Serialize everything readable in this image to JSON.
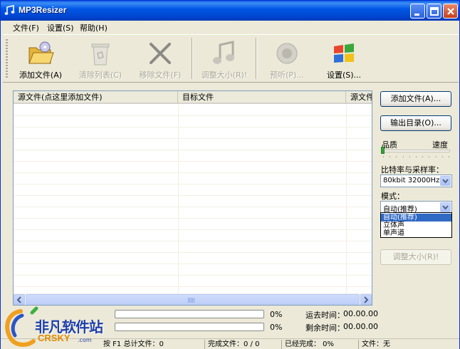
{
  "window": {
    "title": "MP3Resizer"
  },
  "menu": [
    "文件(F)",
    "设置(S)",
    "帮助(H)"
  ],
  "toolbar": {
    "add_files": "添加文件(A)",
    "clear_list": "清除列表(C)",
    "remove_files": "移除文件(F)",
    "resize": "调整大小(R)!",
    "preview": "预听(P)...",
    "settings": "设置(S)..."
  },
  "list": {
    "columns": [
      "源文件(点这里添加文件)",
      "目标文件",
      "源文件"
    ]
  },
  "panel": {
    "add_files_btn": "添加文件(A)...",
    "output_dir_btn": "输出目录(O)...",
    "quality_label": "品质",
    "speed_label": "速度",
    "quality_speed_level": 0,
    "bitrate_label": "比特率与采样率：",
    "bitrate_value": "80kbit 32000Hz",
    "mode_label": "模式：",
    "mode_value": "自动(推荐)",
    "mode_options": [
      "自动(推荐)",
      "立体声",
      "单声道"
    ],
    "resize_btn": "调整大小(R)!"
  },
  "progress": {
    "bar1_percent": "0%",
    "bar2_percent": "0%",
    "bar1_value": 0,
    "bar2_value": 0,
    "elapsed_label": "运去时间：",
    "elapsed_value": "00.00.00",
    "remaining_label": "剩余时间：",
    "remaining_value": "00.00.00"
  },
  "status": {
    "help": "按 F1 总计文件：0",
    "done_files": "完成文件：0 / 0",
    "completed": "已经完成：  0%",
    "file": "文件：无"
  },
  "watermark": {
    "brand": "非凡软件站",
    "sub": "CRSKY",
    "url": ".com"
  },
  "colors": {
    "titlebar": "#0058e6",
    "selection": "#316ac5",
    "progress_fill": "#3cc33c"
  }
}
